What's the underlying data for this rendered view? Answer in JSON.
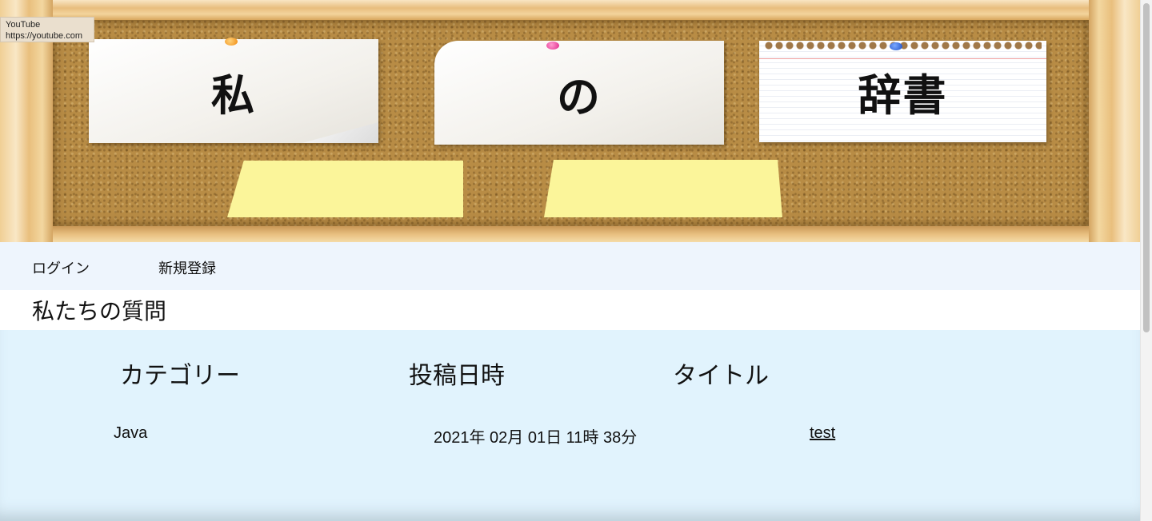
{
  "tooltip": {
    "title": "YouTube",
    "url": "https://youtube.com"
  },
  "banner": {
    "word1": "私",
    "word2": "の",
    "word3": "辞書"
  },
  "nav": {
    "login": "ログイン",
    "register": "新規登録"
  },
  "page_title": "私たちの質問",
  "table": {
    "headers": [
      "カテゴリー",
      "投稿日時",
      "タイトル"
    ],
    "rows": [
      {
        "category": "Java",
        "posted_at": "2021年 02月 01日 11時 38分",
        "title": "test"
      }
    ]
  }
}
